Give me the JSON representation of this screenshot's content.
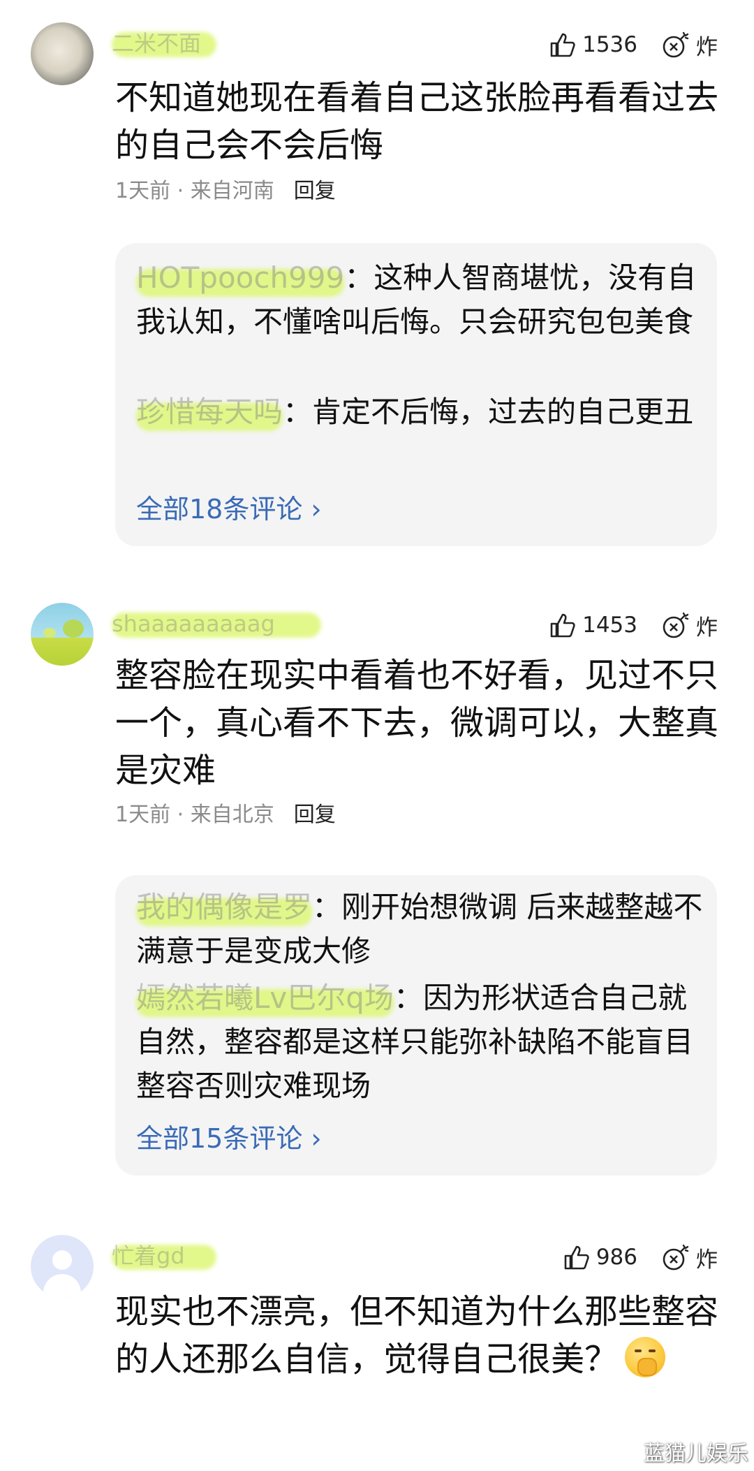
{
  "comments": [
    {
      "username": "二米不面",
      "likes": "1536",
      "bomb_label": "炸",
      "text": "不知道她现在看着自己这张脸再看看过去的自己会不会后悔",
      "meta": "1天前 · 来自河南",
      "reply_label": "回复",
      "replies": [
        {
          "name": "HOTpooch999",
          "text": "这种人智商堪忧，没有自我认知，不懂啥叫后悔。只会研究包包美食"
        },
        {
          "name": "珍惜每天吗",
          "text": "肯定不后悔，过去的自己更丑"
        }
      ],
      "view_all": "全部18条评论 ›"
    },
    {
      "username": "shaaaaaaaaag",
      "likes": "1453",
      "bomb_label": "炸",
      "text": "整容脸在现实中看着也不好看，见过不只一个，真心看不下去，微调可以，大整真是灾难",
      "meta": "1天前 · 来自北京",
      "reply_label": "回复",
      "replies": [
        {
          "name": "我的偶像是罗",
          "text": "刚开始想微调 后来越整越不满意于是变成大修"
        },
        {
          "name": "嫣然若曦Lv巴尔q场",
          "text": "因为形状适合自己就自然，整容都是这样只能弥补缺陷不能盲目整容否则灾难现场"
        }
      ],
      "view_all": "全部15条评论 ›"
    },
    {
      "username": "忙着gd",
      "likes": "986",
      "bomb_label": "炸",
      "text": "现实也不漂亮，但不知道为什么那些整容的人还那么自信，觉得自己很美？",
      "emoji": "hand-over-mouth-emoji"
    }
  ],
  "watermark": "蓝猫儿娱乐"
}
